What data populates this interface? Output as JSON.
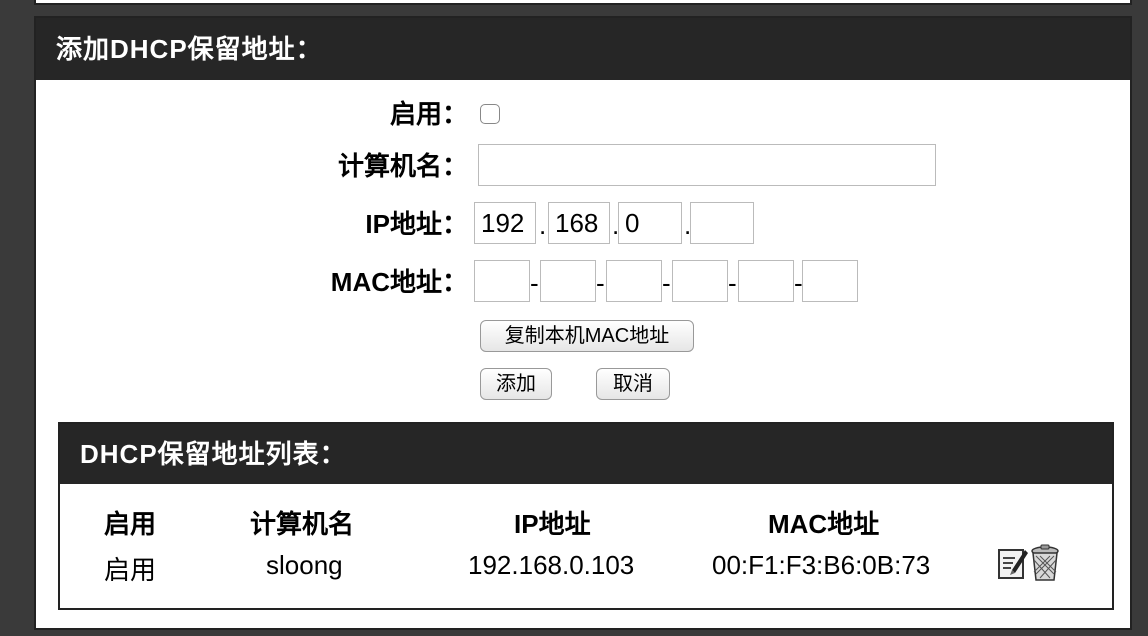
{
  "form": {
    "title": "添加DHCP保留地址：",
    "enable_label": "启用：",
    "enable_checked": false,
    "hostname_label": "计算机名：",
    "hostname_value": "",
    "ip_label": "IP地址：",
    "ip_octets": [
      "192",
      "168",
      "0",
      ""
    ],
    "ip_sep": ".",
    "mac_label": "MAC地址：",
    "mac_octets": [
      "",
      "",
      "",
      "",
      "",
      ""
    ],
    "mac_sep": "-",
    "copy_mac_button": "复制本机MAC地址",
    "add_button": "添加",
    "cancel_button": "取消"
  },
  "list": {
    "title": "DHCP保留地址列表：",
    "columns": [
      "启用",
      "计算机名",
      "IP地址",
      "MAC地址"
    ],
    "rows": [
      {
        "enabled": "启用",
        "hostname": "sloong",
        "ip": "192.168.0.103",
        "mac": "00:F1:F3:B6:0B:73",
        "icons": [
          "edit-icon",
          "trash-icon"
        ]
      }
    ]
  }
}
